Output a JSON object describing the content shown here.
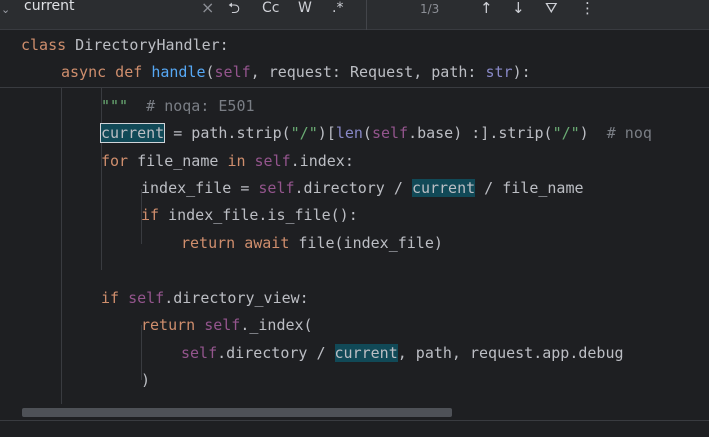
{
  "find_bar": {
    "query": "current",
    "clear_glyph": "×",
    "replace_glyph": "⮌",
    "match_case_label": "Cc",
    "whole_word_label": "W",
    "regex_label": ".*",
    "match_count": "1/3",
    "prev_glyph": "↑",
    "next_glyph": "↓",
    "filter_glyph": "⛛",
    "more_glyph": "⋮"
  },
  "sticky": {
    "line1": {
      "kw": "class",
      "name": " DirectoryHandler:"
    },
    "line2": {
      "kw_async": "async",
      "kw_def": " def ",
      "fn": "handle",
      "open": "(",
      "self": "self",
      "rest1": ", request: Request, path: ",
      "str_type": "str",
      "close": "):"
    }
  },
  "code": {
    "l1": {
      "doc": "\"\"\"",
      "comment": "  # noqa: E501"
    },
    "l2": {
      "var": "current",
      "a": " = path.strip(",
      "s1": "\"/\"",
      "b": ")[",
      "len": "len",
      "c": "(",
      "self": "self",
      "d": ".base) :].strip(",
      "s2": "\"/\"",
      "e": ")  ",
      "comment": "# noq"
    },
    "l3": {
      "for": "for",
      "a": " file_name ",
      "in": "in",
      "b": " ",
      "self": "self",
      "c": ".index:"
    },
    "l4": {
      "a": "index_file = ",
      "self": "self",
      "b": ".directory / ",
      "var": "current",
      "c": " / file_name"
    },
    "l5": {
      "if": "if",
      "a": " index_file.is_file():"
    },
    "l6": {
      "ret": "return",
      "b": " ",
      "await": "await",
      "c": " file(index_file)"
    },
    "l8": {
      "if": "if",
      "a": " ",
      "self": "self",
      "b": ".directory_view:"
    },
    "l9": {
      "ret": "return",
      "a": " ",
      "self": "self",
      "b": "._index("
    },
    "l10": {
      "self": "self",
      "a": ".directory / ",
      "var": "current",
      "b": ", path, request.app.debug"
    },
    "l11": {
      "a": ")"
    }
  }
}
